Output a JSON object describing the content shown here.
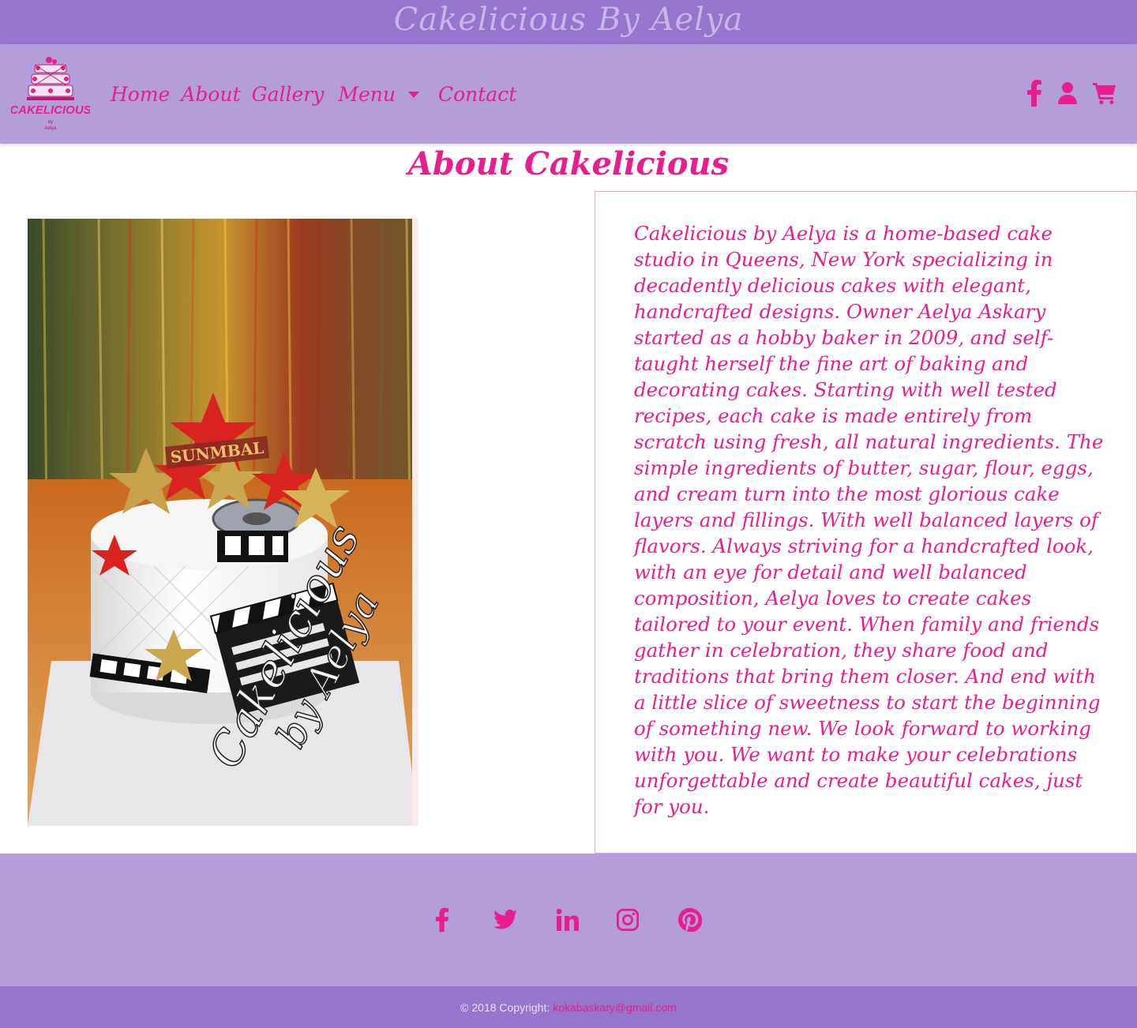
{
  "site": {
    "brand": "Cakelicious By Aelya"
  },
  "navbar": {
    "logo_alt": "Cakelicious by Aelya logo",
    "logo_text": "CAKELICIOUS",
    "links": [
      {
        "label": "Home",
        "icon": null
      },
      {
        "label": "About",
        "icon": null
      },
      {
        "label": "Gallery",
        "icon": null
      },
      {
        "label": "Menu",
        "icon": "caret-down-icon"
      },
      {
        "label": "Contact",
        "icon": null
      }
    ],
    "icons": [
      "facebook-icon",
      "user-icon",
      "shopping-cart-icon"
    ]
  },
  "main": {
    "title": "About Cakelicious",
    "image_alt": "Movie-themed fondant cake with gold and red stars, film reel and clapperboard",
    "image_watermark_lines": [
      "Cakelicious",
      "by Aelya"
    ],
    "image_banner_text": "SUNMBAL",
    "about_text": "Cakelicious by Aelya is a home-based cake studio in Queens, New York specializing in decadently delicious cakes with elegant, handcrafted designs. Owner Aelya Askary started as a hobby baker in 2009, and self-taught herself the fine art of baking and decorating cakes. Starting with well tested recipes, each cake is made entirely from scratch using fresh, all natural ingredients. The simple ingredients of butter, sugar, flour, eggs, and cream turn into the most glorious cake layers and fillings. With well balanced layers of flavors. Always striving for a handcrafted look, with an eye for detail and well balanced composition, Aelya loves to create cakes tailored to your event. When family and friends gather in celebration, they share food and traditions that bring them closer. And end with a little slice of sweetness to start the beginning of something new. We look forward to working with you. We want to make your celebrations unforgettable and create beautiful cakes, just for you."
  },
  "footer": {
    "social_icons": [
      "facebook-icon",
      "twitter-icon",
      "linkedin-icon",
      "instagram-icon",
      "pinterest-icon"
    ],
    "copyright_prefix": "© 2018 Copyright:",
    "email": "kokabaskary@gmail.com"
  },
  "colors": {
    "banner": "#9575cd",
    "navbar": "#b39ddb",
    "accent": "#e91e8c",
    "brand_text": "#c7b6ea"
  }
}
